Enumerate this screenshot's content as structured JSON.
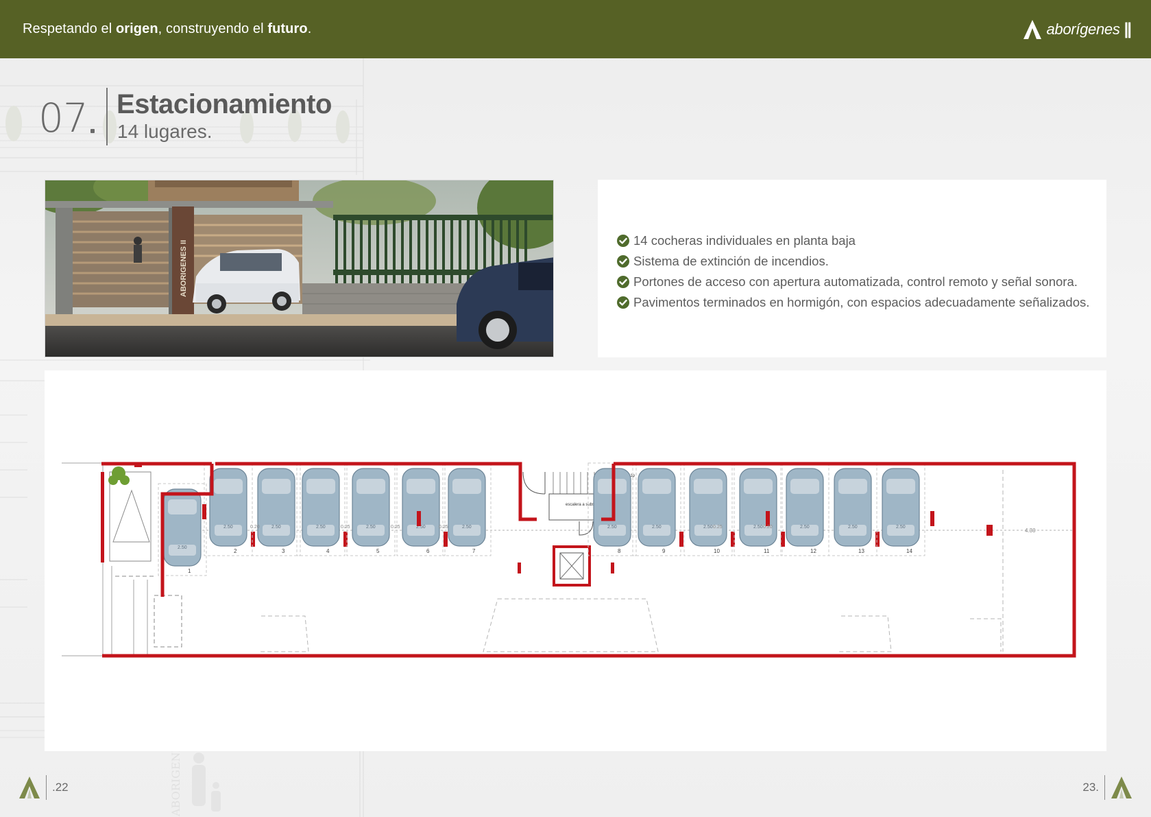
{
  "header": {
    "tagline_part1": "Respetando el ",
    "tagline_bold1": "origen",
    "tagline_part2": ", construyendo el ",
    "tagline_bold2": "futuro",
    "tagline_part3": ".",
    "brand_name": "aborígenes",
    "brand_suffix": "||"
  },
  "section": {
    "number": "07",
    "title": "Estacionamiento",
    "subtitle": "14 lugares."
  },
  "photo": {
    "sign_text": "ABORIGENES II"
  },
  "features": [
    "14 cocheras individuales en planta baja",
    "Sistema de extinción de incendios.",
    "Portones de acceso con apertura automatizada, control remoto y señal sonora.",
    "Pavimentos terminados en hormigón, con espacios adecuadamente señalizados."
  ],
  "plan": {
    "width_label": "2.50",
    "gap_labels": [
      "0.20",
      "0.25",
      "0.25",
      "0.25",
      "0.25",
      "0.20"
    ],
    "end_label": "4.30",
    "stair_label_1": "escalera a 1p",
    "stair_label_2": "escalera a subsuelo",
    "space_numbers": [
      "1",
      "2",
      "3",
      "4",
      "5",
      "6",
      "7",
      "8",
      "9",
      "10",
      "11",
      "12",
      "13",
      "14"
    ]
  },
  "footer": {
    "left_page": ".22",
    "right_page": "23."
  },
  "colors": {
    "header_bg": "#566125",
    "wall_red": "#c3141b",
    "check_green": "#4f6b2c",
    "car_blue": "#9fb6c6"
  }
}
